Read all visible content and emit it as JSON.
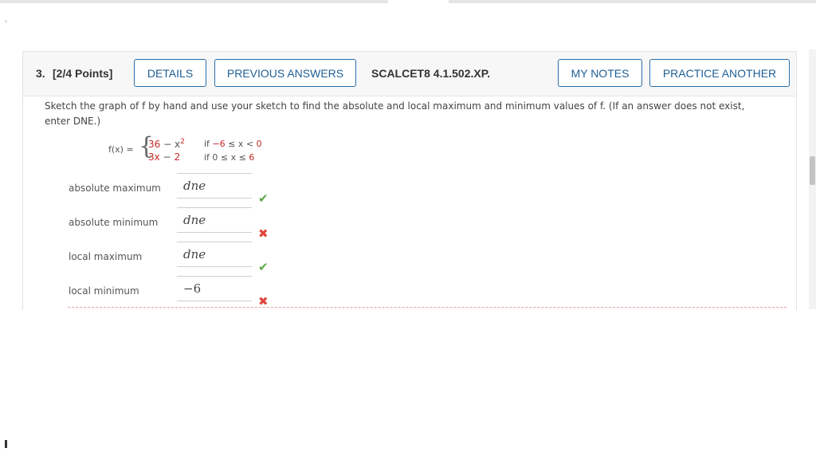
{
  "question": {
    "number": "3.",
    "points": "[2/4 Points]",
    "code": "SCALCET8 4.1.502.XP."
  },
  "buttons": {
    "details": "DETAILS",
    "previous_answers": "PREVIOUS ANSWERS",
    "my_notes": "MY NOTES",
    "practice_another": "PRACTICE ANOTHER"
  },
  "prompt": {
    "text": "Sketch the graph of f by hand and use your sketch to find the absolute and local maximum and minimum values of f. (If an answer does not exist, enter DNE.)"
  },
  "function": {
    "label": "f(x) =",
    "piece1_expr_a": "36",
    "piece1_expr_b": " − x",
    "piece1_exp": "2",
    "piece1_cond_a": "if ",
    "piece1_cond_b": "−6",
    "piece1_cond_c": " ≤ x < ",
    "piece1_cond_d": "0",
    "piece2_expr_a": "3x",
    "piece2_expr_b": " − ",
    "piece2_expr_c": "2",
    "piece2_cond_a": "if 0 ≤ x ≤ ",
    "piece2_cond_b": "6"
  },
  "answers": [
    {
      "label": "absolute maximum",
      "value": "dne",
      "status": "correct"
    },
    {
      "label": "absolute minimum",
      "value": "dne",
      "status": "incorrect"
    },
    {
      "label": "local maximum",
      "value": "dne",
      "status": "correct"
    },
    {
      "label": "local minimum",
      "value": "−6",
      "status": "incorrect"
    }
  ],
  "icons": {
    "correct": "check-icon",
    "incorrect": "cross-icon"
  },
  "colors": {
    "button_border": "#2a6ea8",
    "correct": "#5aa846",
    "incorrect": "#e0453c",
    "highlight_red": "#c62828"
  }
}
